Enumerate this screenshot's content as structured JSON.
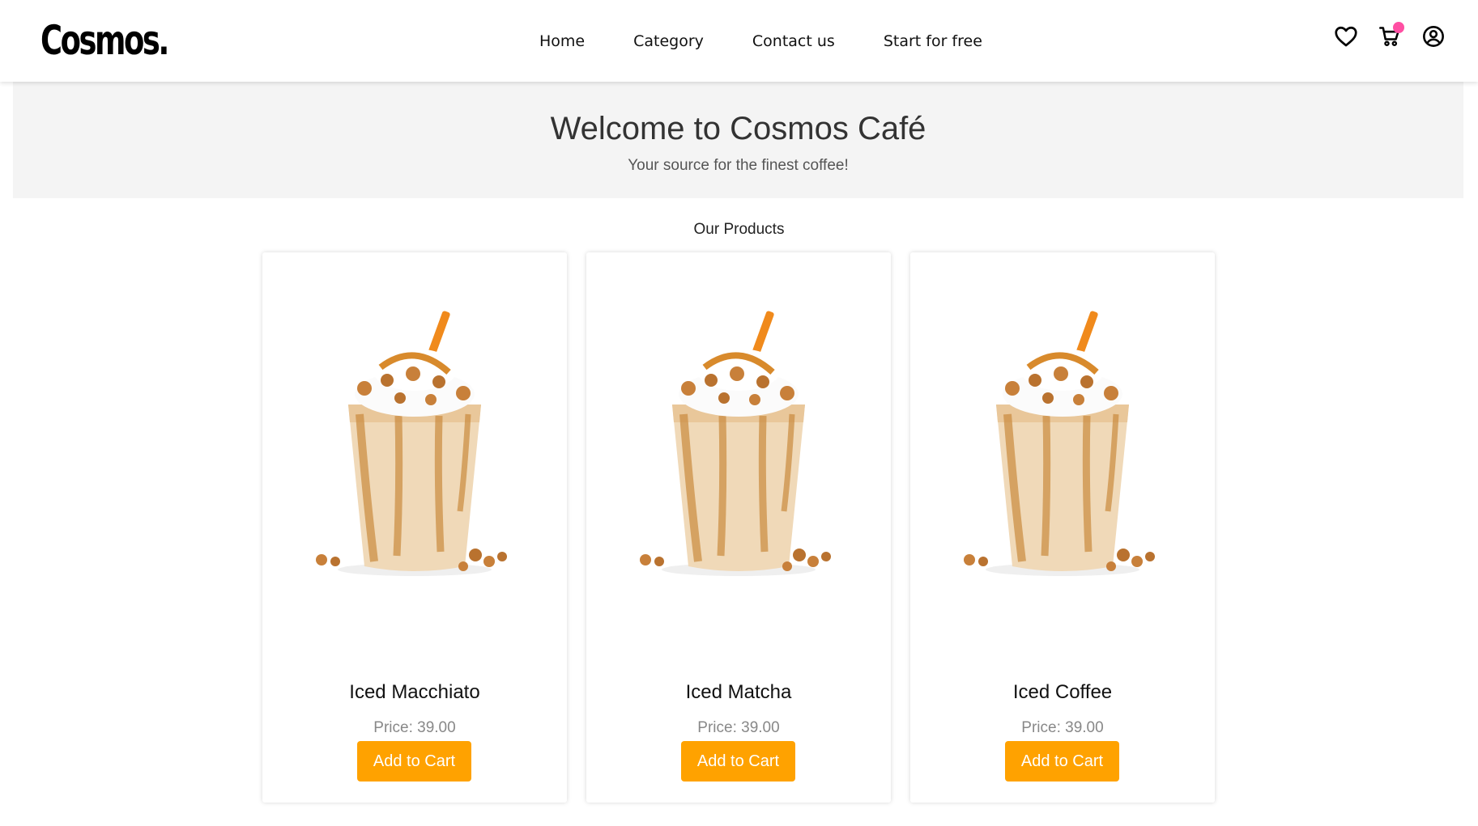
{
  "brand": {
    "logo_text": "Cosmos."
  },
  "nav": {
    "items": [
      {
        "label": "Home"
      },
      {
        "label": "Category"
      },
      {
        "label": "Contact us"
      },
      {
        "label": "Start for free"
      }
    ]
  },
  "header_icons": [
    "heart-icon",
    "cart-icon",
    "user-icon"
  ],
  "colors": {
    "accent": "#ffa200",
    "cart_badge": "#ff4fa3",
    "hero_bg": "#f4f4f4"
  },
  "hero": {
    "title": "Welcome to Cosmos Café",
    "subtitle": "Your source for the finest coffee!"
  },
  "products_section": {
    "title": "Our Products",
    "products": [
      {
        "name": "Iced Macchiato",
        "price_text": "Price: 39.00",
        "button_label": "Add to Cart"
      },
      {
        "name": "Iced Matcha",
        "price_text": "Price: 39.00",
        "button_label": "Add to Cart"
      },
      {
        "name": "Iced Coffee",
        "price_text": "Price: 39.00",
        "button_label": "Add to Cart"
      }
    ]
  }
}
